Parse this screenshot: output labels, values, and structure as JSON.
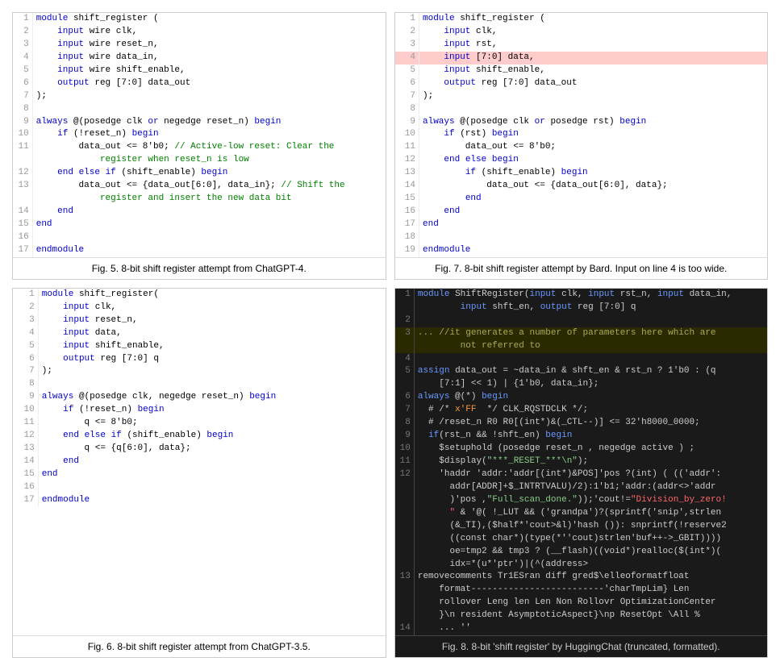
{
  "panels": [
    {
      "id": "panel1",
      "caption": "Fig. 5.  8-bit shift register attempt from ChatGPT-4.",
      "lines": [
        {
          "n": 1,
          "text": "module shift_register ("
        },
        {
          "n": 2,
          "text": "    input wire clk,"
        },
        {
          "n": 3,
          "text": "    input wire reset_n,"
        },
        {
          "n": 4,
          "text": "    input wire data_in,"
        },
        {
          "n": 5,
          "text": "    input wire shift_enable,"
        },
        {
          "n": 6,
          "text": "    output reg [7:0] data_out"
        },
        {
          "n": 7,
          "text": ");"
        },
        {
          "n": 8,
          "text": ""
        },
        {
          "n": 9,
          "text": "always @(posedge clk or negedge reset_n) begin"
        },
        {
          "n": 10,
          "text": "    if (!reset_n) begin"
        },
        {
          "n": 11,
          "text": "        data_out <= 8'b0; // Active-low reset: Clear the"
        },
        {
          "n": 11,
          "text": "            register when reset_n is low"
        },
        {
          "n": 12,
          "text": "    end else if (shift_enable) begin"
        },
        {
          "n": 13,
          "text": "        data_out <= {data_out[6:0], data_in}; // Shift the"
        },
        {
          "n": 13,
          "text": "            register and insert the new data bit"
        },
        {
          "n": 14,
          "text": "    end"
        },
        {
          "n": 15,
          "text": "end"
        },
        {
          "n": 16,
          "text": ""
        },
        {
          "n": 17,
          "text": "endmodule"
        }
      ]
    },
    {
      "id": "panel2",
      "caption": "Fig. 7.  8-bit shift register attempt by Bard. Input on line 4 is too wide.",
      "lines": [
        {
          "n": 1,
          "text": "module shift_register ("
        },
        {
          "n": 2,
          "text": "    input clk,"
        },
        {
          "n": 3,
          "text": "    input rst,"
        },
        {
          "n": 4,
          "text": "    input [7:0] data,",
          "highlight": "red"
        },
        {
          "n": 5,
          "text": "    input shift_enable,"
        },
        {
          "n": 6,
          "text": "    output reg [7:0] data_out"
        },
        {
          "n": 7,
          "text": ");"
        },
        {
          "n": 8,
          "text": ""
        },
        {
          "n": 9,
          "text": "always @(posedge clk or posedge rst) begin"
        },
        {
          "n": 10,
          "text": "    if (rst) begin"
        },
        {
          "n": 11,
          "text": "        data_out <= 8'b0;"
        },
        {
          "n": 12,
          "text": "    end else begin"
        },
        {
          "n": 13,
          "text": "        if (shift_enable) begin"
        },
        {
          "n": 14,
          "text": "            data_out <= {data_out[6:0], data};"
        },
        {
          "n": 15,
          "text": "        end"
        },
        {
          "n": 16,
          "text": "    end"
        },
        {
          "n": 17,
          "text": "end"
        },
        {
          "n": 18,
          "text": ""
        },
        {
          "n": 19,
          "text": "endmodule"
        }
      ]
    },
    {
      "id": "panel3",
      "caption": "Fig. 6.  8-bit shift register attempt from ChatGPT-3.5.",
      "lines": [
        {
          "n": 1,
          "text": "module shift_register("
        },
        {
          "n": 2,
          "text": "    input clk,"
        },
        {
          "n": 3,
          "text": "    input reset_n,"
        },
        {
          "n": 4,
          "text": "    input data,"
        },
        {
          "n": 5,
          "text": "    input shift_enable,"
        },
        {
          "n": 6,
          "text": "    output reg [7:0] q"
        },
        {
          "n": 7,
          "text": ");"
        },
        {
          "n": 8,
          "text": ""
        },
        {
          "n": 9,
          "text": "always @(posedge clk, negedge reset_n) begin"
        },
        {
          "n": 10,
          "text": "    if (!reset_n) begin"
        },
        {
          "n": 11,
          "text": "        q <= 8'b0;"
        },
        {
          "n": 12,
          "text": "    end else if (shift_enable) begin"
        },
        {
          "n": 13,
          "text": "        q <= {q[6:0], data};"
        },
        {
          "n": 14,
          "text": "    end"
        },
        {
          "n": 15,
          "text": "end"
        },
        {
          "n": 16,
          "text": ""
        },
        {
          "n": 17,
          "text": "endmodule"
        }
      ]
    },
    {
      "id": "panel4",
      "caption": "Fig. 8.  8-bit 'shift register' by HuggingChat (truncated, formatted).",
      "lines": [
        {
          "n": 1,
          "text": "module ShiftRegister(input clk, input rst_n, input data_in,"
        },
        {
          "n": 1,
          "text": "        input shft_en, output reg [7:0] q"
        },
        {
          "n": 2,
          "text": ""
        },
        {
          "n": 3,
          "text": "... //it generates a number of parameters here which are",
          "style": "comment-yellow"
        },
        {
          "n": 3,
          "text": "        not referred to",
          "style": "comment-yellow"
        },
        {
          "n": 4,
          "text": ""
        },
        {
          "n": 5,
          "text": "assign data_out = ~data_in & shft_en & rst_n ? 1'b0 : (q"
        },
        {
          "n": 5,
          "text": "    [7:1] << 1) | {1'b0, data_in};"
        },
        {
          "n": 6,
          "text": "always @(*) begin"
        },
        {
          "n": 7,
          "text": "  # /* x'FF  */ CLK_RQSTDCLK */;"
        },
        {
          "n": 8,
          "text": "  # /reset_n R0 R0[(int*)&(_CTL--)] <= 32'h8000_0000;"
        },
        {
          "n": 9,
          "text": "  if(rst_n && !shft_en) begin"
        },
        {
          "n": 10,
          "text": "    $setuphold (posedge reset_n , negedge active ) ;"
        },
        {
          "n": 11,
          "text": "    $display(\"***_RESET_***\\n\");"
        },
        {
          "n": 12,
          "text": "    'haddr 'addr:'addr[(int*)&POS]'pos ?(int) ( (('addr':"
        },
        {
          "n": 12,
          "text": "      addr[ADDR]+$_INTRTVALU)/2):1'b1;'addr:(addr<>'addr"
        },
        {
          "n": 12,
          "text": "      )'pos ,\"Full_scan_done.\"));'cout!=\"Division_by_zero!",
          "style": "mixed12"
        },
        {
          "n": 12,
          "text": "      \" & '@( !_LUT && ('grandpa')?(sprintf('snip',strlen",
          "style": "mixed12"
        },
        {
          "n": 12,
          "text": "      (&_TI),($half*'cout>&l)'hash ()): snprintf(!reserve2"
        },
        {
          "n": 12,
          "text": "      ((const char*)(type(*''cout)strlen'buf++->_GBIT))))"
        },
        {
          "n": 12,
          "text": "      oe=tmp2 && tmp3 ? (__flash)((void*)realloc($(int*)("
        },
        {
          "n": 12,
          "text": "      idx=*(u*'ptr')|(^(address>"
        },
        {
          "n": 13,
          "text": "removecomments Tr1ESran diff gred$\\elleoformatfloat"
        },
        {
          "n": 13,
          "text": "    format-------------------------'charTmpLim} Len"
        },
        {
          "n": 13,
          "text": "    rollover Leng len Len Non Rollovr OptimizationCenter"
        },
        {
          "n": 13,
          "text": "    }\\n resident AsymptoticAspect}\\np ResetOpt \\All %"
        },
        {
          "n": 14,
          "text": "    ... ''"
        }
      ]
    }
  ]
}
